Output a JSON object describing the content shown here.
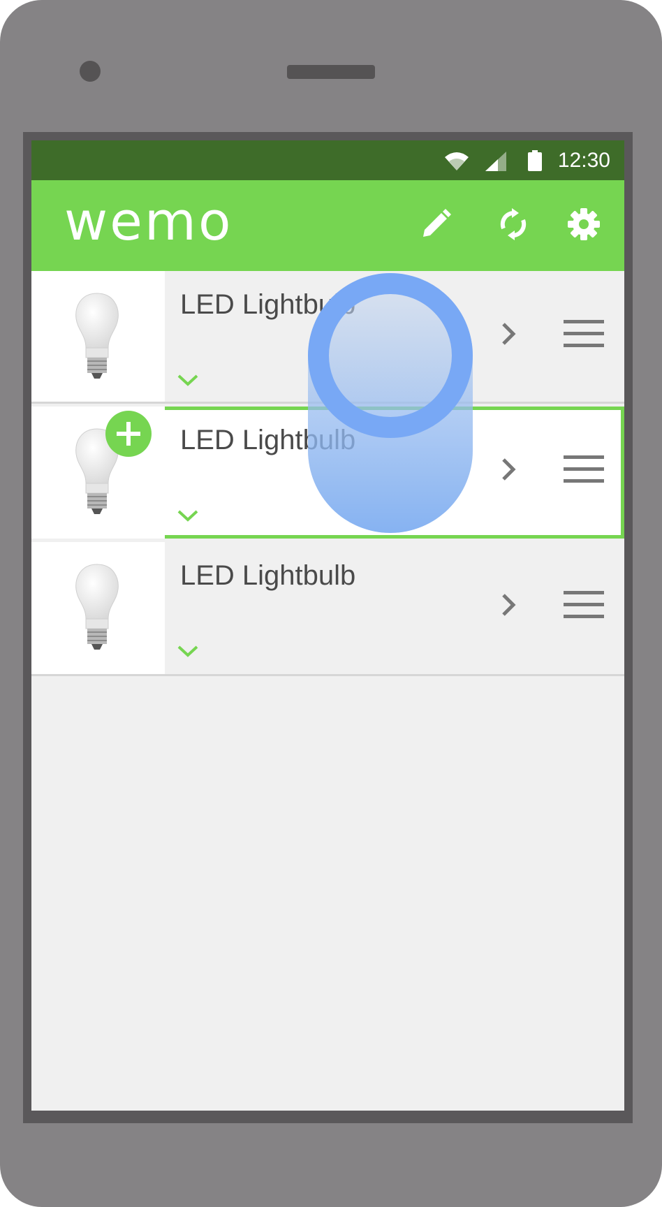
{
  "status_bar": {
    "time": "12:30"
  },
  "app_bar": {
    "logo": "wemo",
    "icons": [
      "pencil-icon",
      "refresh-icon",
      "gear-icon"
    ]
  },
  "devices": [
    {
      "name": "LED Lightbulb",
      "selected": false
    },
    {
      "name": "LED Lightbulb",
      "selected": true,
      "badge": "add-icon"
    },
    {
      "name": "LED Lightbulb",
      "selected": false
    }
  ],
  "colors": {
    "status_bar": "#3e6c29",
    "app_bar": "#76d551",
    "accent": "#76d551",
    "touch_indicator": "#78a8f5",
    "phone_body": "#858385"
  }
}
